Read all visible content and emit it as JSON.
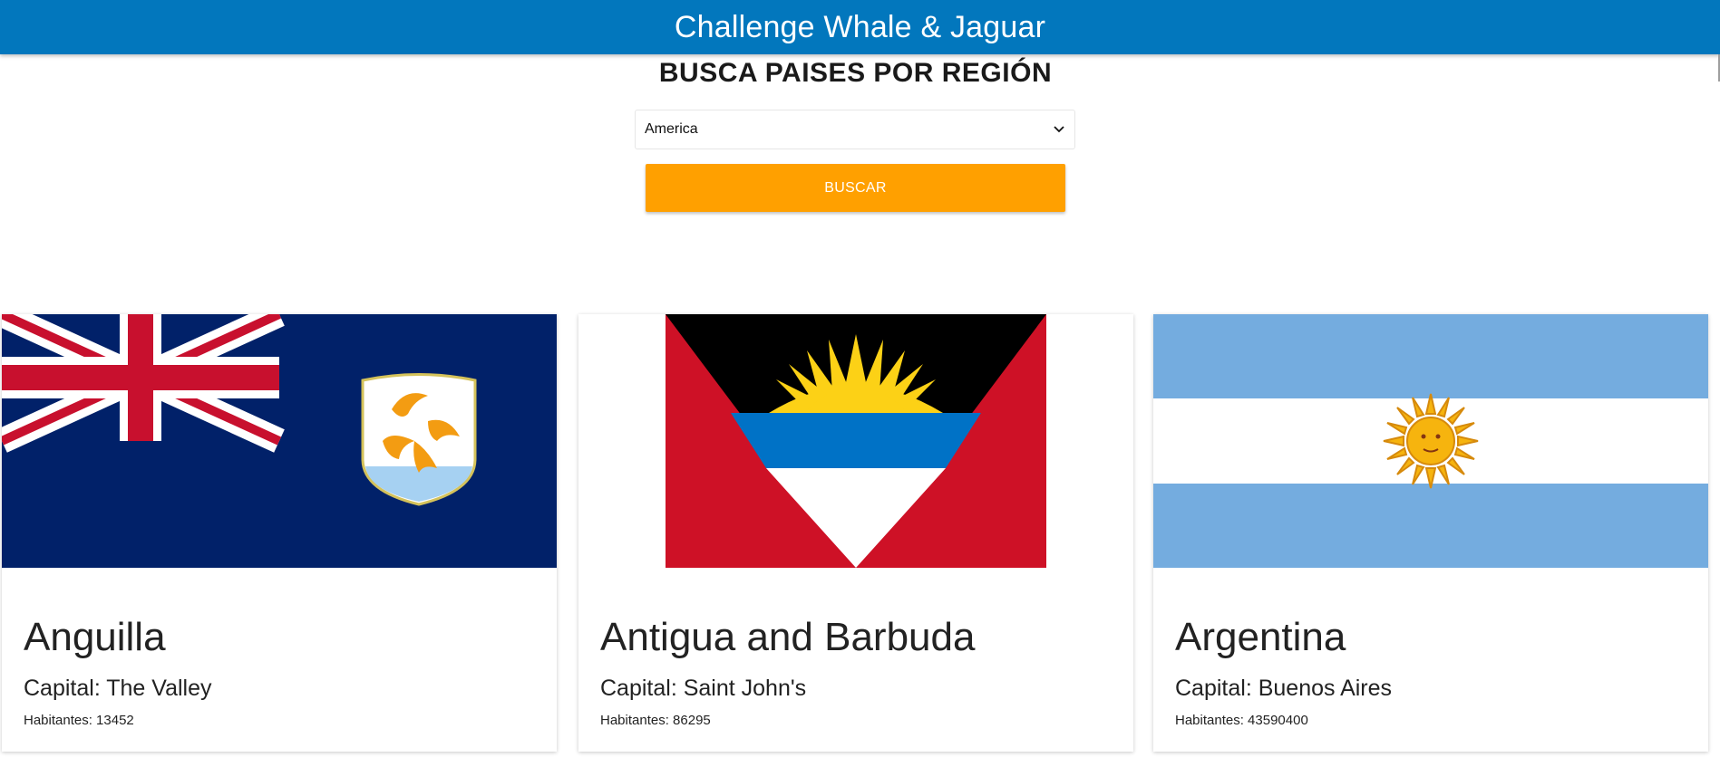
{
  "header": {
    "title": "Challenge Whale & Jaguar"
  },
  "search": {
    "title": "BUSCA PAISES POR REGIÓN",
    "region_selected": "America",
    "button_label": "BUSCAR"
  },
  "countries": [
    {
      "name": "Anguilla",
      "capital": "Capital: The Valley",
      "population": "Habitantes: 13452",
      "flag_icon": "anguilla-flag"
    },
    {
      "name": "Antigua and Barbuda",
      "capital": "Capital: Saint John's",
      "population": "Habitantes: 86295",
      "flag_icon": "antigua-and-barbuda-flag"
    },
    {
      "name": "Argentina",
      "capital": "Capital: Buenos Aires",
      "population": "Habitantes: 43590400",
      "flag_icon": "argentina-flag"
    }
  ],
  "colors": {
    "header_bg": "#0277bd",
    "button_bg": "#ffa000"
  }
}
